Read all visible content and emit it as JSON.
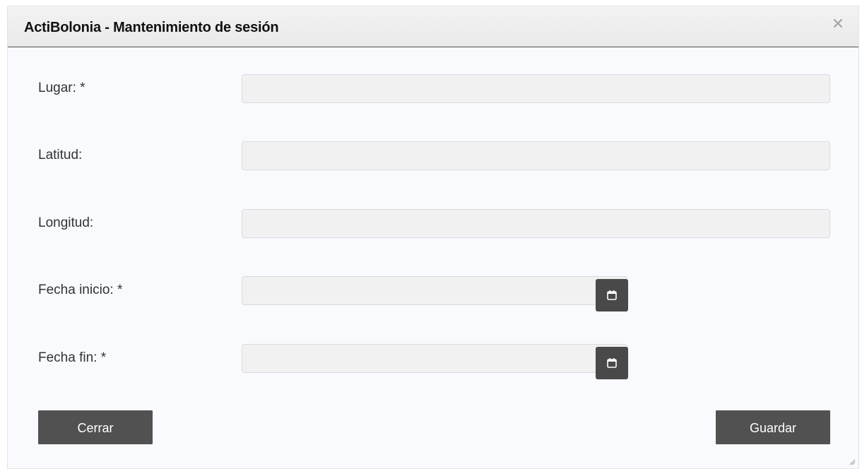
{
  "dialog": {
    "title": "ActiBolonia - Mantenimiento de sesión",
    "close_icon": "close-icon"
  },
  "form": {
    "lugar": {
      "label": "Lugar: *",
      "value": ""
    },
    "latitud": {
      "label": "Latitud:",
      "value": ""
    },
    "longitud": {
      "label": "Longitud:",
      "value": ""
    },
    "fecha_inicio": {
      "label": "Fecha inicio: *",
      "value": "",
      "icon": "calendar-icon"
    },
    "fecha_fin": {
      "label": "Fecha fin: *",
      "value": "",
      "icon": "calendar-icon"
    }
  },
  "buttons": {
    "close_label": "Cerrar",
    "save_label": "Guardar"
  },
  "colors": {
    "button_bg": "#515151",
    "input_bg": "#f1f1f2",
    "dialog_bg": "#f8fafd"
  }
}
